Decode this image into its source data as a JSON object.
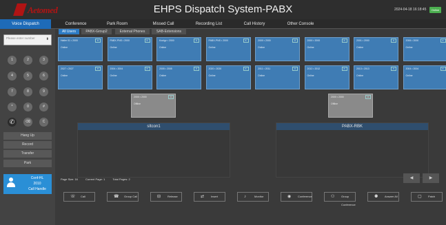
{
  "header": {
    "brand": "Aetomed",
    "title": "EHPS Dispatch System-PABX",
    "datetime": "2024-04-18 16:18:45",
    "status": "Online"
  },
  "nav": {
    "tabs": [
      "Voice Dispatch",
      "Conference",
      "Park Room",
      "Missed Call",
      "Recording List",
      "Call History",
      "Other Console"
    ],
    "active": "Voice Dispatch"
  },
  "dialpad": {
    "placeholder": "Please enter number",
    "keys": [
      "1",
      "2",
      "3",
      "4",
      "5",
      "6",
      "7",
      "8",
      "9",
      "*",
      "0",
      "#"
    ],
    "call_icon": "phone-icon",
    "delete_key": "⌫",
    "clear_key": "C"
  },
  "side_actions": [
    "Hang Up",
    "Record",
    "Transfer",
    "Park"
  ],
  "user": {
    "line1": "Conf-HL",
    "line2": "2010",
    "line3": "Call Handle"
  },
  "sub_tabs": [
    "All Users",
    "PABX-Group2",
    "External Phones",
    "SAB-Extensions"
  ],
  "extensions_row1": [
    {
      "number": "Haller 01 • 2000",
      "status": "Online"
    },
    {
      "number": "PABX-PNS • 2000",
      "status": "Online"
    },
    {
      "number": "Koolgz • 2000",
      "status": "Online"
    },
    {
      "number": "PABX-PNS • 2000",
      "status": "Online"
    },
    {
      "number": "2000 • 2000",
      "status": "Online"
    },
    {
      "number": "2000 • 2000",
      "status": "Online"
    },
    {
      "number": "2001 • 2000",
      "status": "Online"
    },
    {
      "number": "2006 • 2000",
      "status": "Online"
    }
  ],
  "extensions_row2": [
    {
      "number": "2027 • 2027",
      "status": "Online"
    },
    {
      "number": "2004 • 2004",
      "status": "Online"
    },
    {
      "number": "2005 • 2005",
      "status": "Online"
    },
    {
      "number": "2020 • 2020",
      "status": "Online"
    },
    {
      "number": "2011 • 2011",
      "status": "Online"
    },
    {
      "number": "2012 • 2012",
      "status": "Online"
    },
    {
      "number": "2013 • 2013",
      "status": "Online"
    },
    {
      "number": "2004 • 2004",
      "status": "Online"
    }
  ],
  "group_cards": [
    {
      "number": "2000 • 2000",
      "status": "Offline"
    },
    {
      "number": "2000 • 2000",
      "status": "Offline"
    }
  ],
  "panels": [
    "sItcon1",
    "PABX-RBK"
  ],
  "paging": {
    "page_size": "Page Size: 16",
    "current_page": "Current Page: 1",
    "total_pages": "Total Pages: 2",
    "prev": "◀",
    "next": "▶"
  },
  "actions": [
    {
      "label": "Call",
      "icon": "☏"
    },
    {
      "label": "Group Call",
      "icon": "☎"
    },
    {
      "label": "Release",
      "icon": "⊟"
    },
    {
      "label": "Insert",
      "icon": "⇄"
    },
    {
      "label": "Monitor",
      "icon": "♪"
    },
    {
      "label": "Conference",
      "icon": "◉"
    },
    {
      "label": "Group Conference",
      "icon": "⚇"
    },
    {
      "label": "Answer All",
      "icon": "⚉"
    },
    {
      "label": "Patch",
      "icon": "▢"
    }
  ],
  "colors": {
    "accent": "#1e6bb8",
    "card": "#3f7cb4",
    "offline_card": "#8a8a8a",
    "status_green": "#4caf50",
    "brand_red": "#b01414"
  }
}
